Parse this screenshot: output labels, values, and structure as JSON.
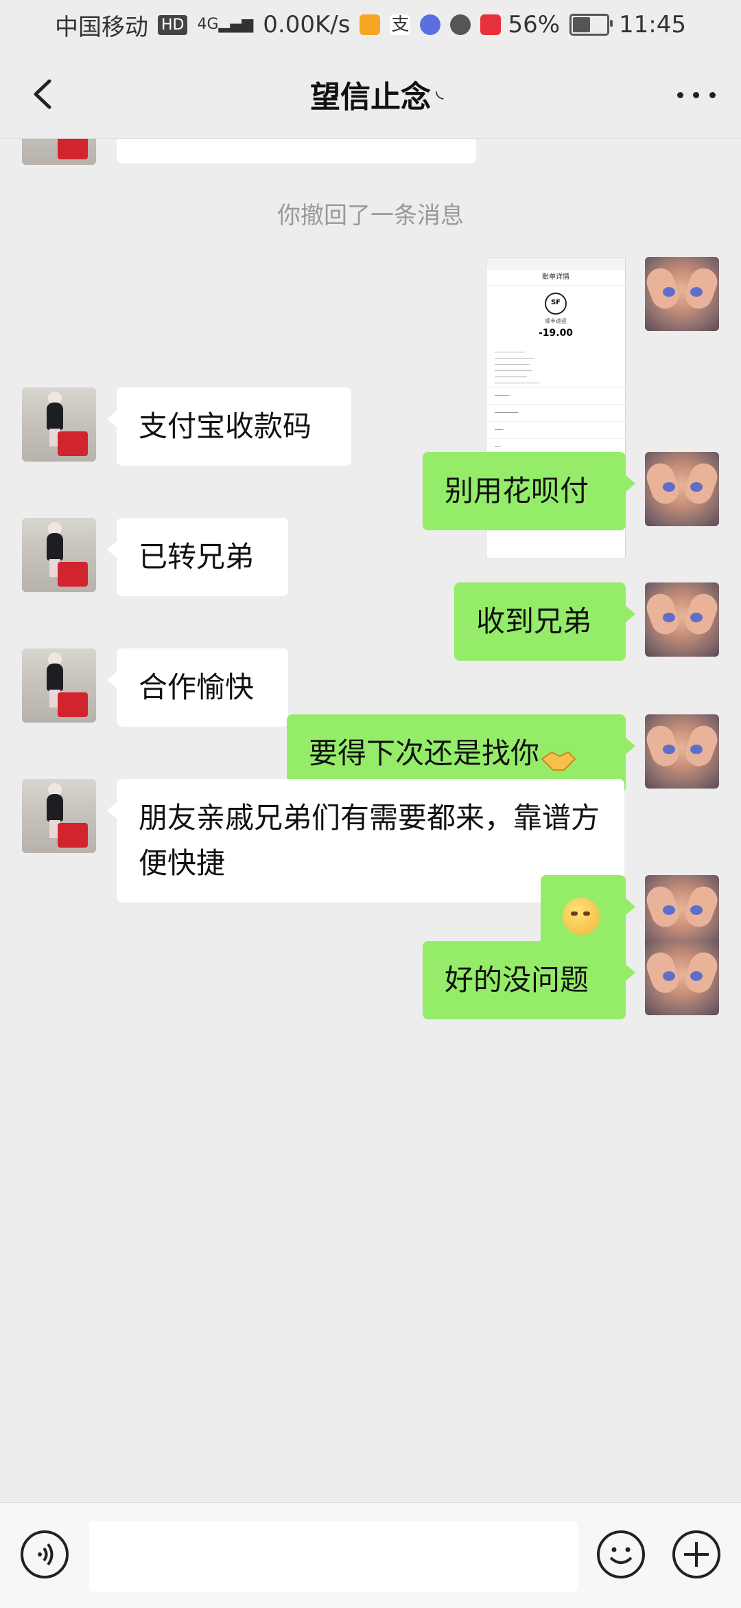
{
  "status_bar": {
    "carrier": "中国移动",
    "hd": "HD",
    "network": "4G",
    "speed": "0.00K/s",
    "battery": "56%",
    "battery_level": 0.56,
    "time": "11:45"
  },
  "header": {
    "title": "望信止念",
    "icons": [
      "back-icon",
      "more-icon"
    ]
  },
  "chat": {
    "system_note": "你撤回了一条消息",
    "screenshot_image": {
      "title": "账单详情",
      "merchant": "顺丰速运",
      "amount": "-19.00",
      "logo": "SF"
    },
    "messages": [
      {
        "from": "other",
        "text": "支付宝收款码"
      },
      {
        "from": "self",
        "text": "别用花呗付"
      },
      {
        "from": "other",
        "text": "已转兄弟"
      },
      {
        "from": "self",
        "text": "收到兄弟"
      },
      {
        "from": "other",
        "text": "合作愉快"
      },
      {
        "from": "self",
        "text": "要得下次还是找你"
      },
      {
        "from": "other",
        "text": "朋友亲戚兄弟们有需要都来，靠谱方便快捷"
      },
      {
        "from": "self",
        "emoji": "smirk-emoji"
      },
      {
        "from": "self",
        "text": "好的没问题"
      }
    ]
  },
  "input_bar": {
    "value": "",
    "icons": [
      "voice-icon",
      "emoji-icon",
      "plus-icon"
    ]
  }
}
